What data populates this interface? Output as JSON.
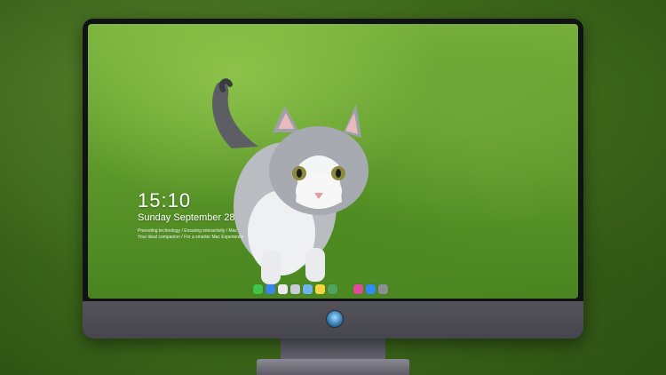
{
  "lockscreen": {
    "time": "15:10",
    "date": "Sunday September 28",
    "notice_line1": "Preceding technology / Ensuring interactivity / Mac",
    "notice_line2": "Your ideal companion / For a smarter Mac Experience"
  },
  "dock": {
    "apps": [
      {
        "name": "Messages",
        "icon": "chat-bubble-icon",
        "color": "#3fc44a"
      },
      {
        "name": "Finder",
        "icon": "finder-icon",
        "color": "#3a86e8"
      },
      {
        "name": "Safari",
        "icon": "compass-icon",
        "color": "#e9e9ee"
      },
      {
        "name": "Photos",
        "icon": "photos-icon",
        "color": "#c8cdd6"
      },
      {
        "name": "Final Cut",
        "icon": "clapper-icon",
        "color": "#6fb5ea"
      },
      {
        "name": "Notes",
        "icon": "notes-icon",
        "color": "#f5d442"
      },
      {
        "name": "Preview",
        "icon": "preview-icon",
        "color": "#4fa35a"
      },
      {
        "name": "Music",
        "icon": "music-note-icon",
        "color": "#e04a9a"
      },
      {
        "name": "App Store",
        "icon": "app-store-icon",
        "color": "#2f8cf0"
      },
      {
        "name": "Screenshot",
        "icon": "camera-icon",
        "color": "#8e8e96"
      }
    ]
  }
}
